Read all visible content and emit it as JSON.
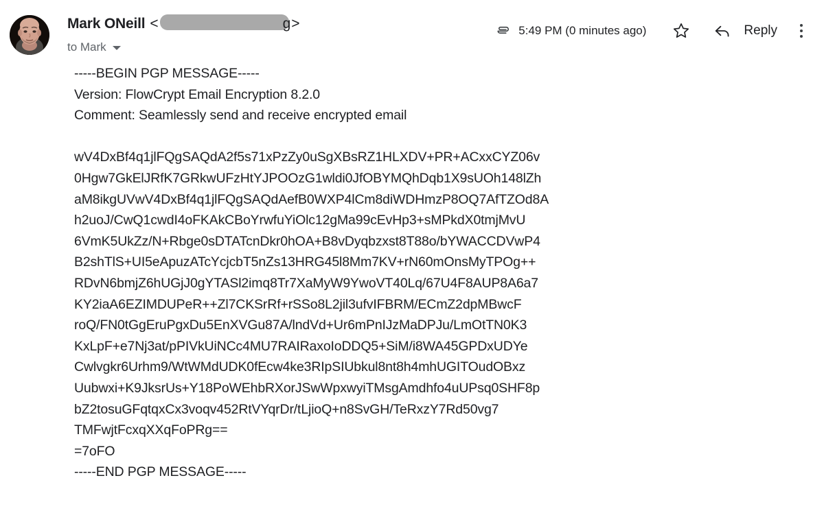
{
  "message": {
    "sender_name": "Mark ONeill",
    "sender_email_redacted": true,
    "email_open_bracket": "<",
    "email_visible_tail": "g",
    "email_close_bracket": ">",
    "recipient": "to Mark",
    "timestamp": "5:49 PM (0 minutes ago)",
    "reply_label": "Reply",
    "icons": {
      "attachment": "paperclip-icon",
      "star": "star-icon",
      "reply": "reply-arrow-icon",
      "more": "more-options-icon",
      "recipient_caret": "chevron-down-icon",
      "avatar": "avatar-photo"
    },
    "colors": {
      "text": "#202124",
      "secondary_text": "#5f6368",
      "redaction": "#a9a9a9",
      "background": "#ffffff"
    }
  },
  "pgp": {
    "begin_marker": "-----BEGIN PGP MESSAGE-----",
    "version": "Version: FlowCrypt Email Encryption 8.2.0",
    "comment": "Comment: Seamlessly send and receive encrypted email",
    "blank": "",
    "body_lines": [
      "wV4DxBf4q1jlFQgSAQdA2f5s71xPzZy0uSgXBsRZ1HLXDV+PR+ACxxCYZ06v",
      "0Hgw7GkElJRfK7GRkwUFzHtYJPOOzG1wldi0JfOBYMQhDqb1X9sUOh148lZh",
      "aM8ikgUVwV4DxBf4q1jlFQgSAQdAefB0WXP4lCm8diWDHmzP8OQ7AfTZOd8A",
      "h2uoJ/CwQ1cwdI4oFKAkCBoYrwfuYiOlc12gMa99cEvHp3+sMPkdX0tmjMvU",
      "6VmK5UkZz/N+Rbge0sDTATcnDkr0hOA+B8vDyqbzxst8T88o/bYWACCDVwP4",
      "B2shTlS+UI5eApuzATcYcjcbT5nZs13HRG45l8Mm7KV+rN60mOnsMyTPOg++",
      "RDvN6bmjZ6hUGjJ0gYTASl2imq8Tr7XaMyW9YwoVT40Lq/67U4F8AUP8A6a7",
      "KY2iaA6EZIMDUPeR++Zl7CKSrRf+rSSo8L2jil3ufvIFBRM/ECmZ2dpMBwcF",
      "roQ/FN0tGgEruPgxDu5EnXVGu87A/lndVd+Ur6mPnIJzMaDPJu/LmOtTN0K3",
      "KxLpF+e7Nj3at/pPIVkUiNCc4MU7RAIRaxoIoDDQ5+SiM/i8WA45GPDxUDYe",
      "Cwlvgkr6Urhm9/WtWMdUDK0fEcw4ke3RIpSIUbkul8nt8h4mhUGITOudOBxz",
      "Uubwxi+K9JksrUs+Y18PoWEhbRXorJSwWpxwyiTMsgAmdhfo4uUPsq0SHF8p",
      "bZ2tosuGFqtqxCx3voqv452RtVYqrDr/tLjioQ+n8SvGH/TeRxzY7Rd50vg7",
      "TMFwjtFcxqXXqFoPRg==",
      "=7oFO"
    ],
    "end_marker": "-----END PGP MESSAGE-----"
  }
}
